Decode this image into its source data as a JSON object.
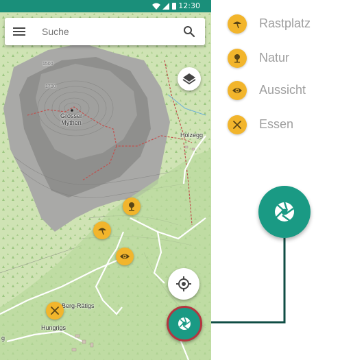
{
  "status_bar": {
    "time": "12:30"
  },
  "search": {
    "placeholder": "Suche"
  },
  "map_labels": {
    "peak": "Grosser\nMythen",
    "holzegg": "Holzegg",
    "berg_ratigs": "Berg-Rätigs",
    "hungrigs": "Hungrigs",
    "contour_a": "1500",
    "contour_b": "1700",
    "edge_g": "g"
  },
  "legend": [
    {
      "label": "Rastplatz",
      "icon": "picnic-umbrella-icon"
    },
    {
      "label": "Natur",
      "icon": "tree-icon"
    },
    {
      "label": "Aussicht",
      "icon": "eye-icon"
    },
    {
      "label": "Essen",
      "icon": "fork-knife-icon"
    }
  ],
  "colors": {
    "accent": "#1a9a84",
    "status_bar": "#1a8f7a",
    "poi": "#f2b52c",
    "camera_ring": "#b4353f",
    "connector": "#0f4d44",
    "legend_text": "#9e9e9e"
  },
  "icons": {
    "menu": "menu-icon",
    "search": "search-icon",
    "layers": "layers-icon",
    "locate": "gps-locate-icon",
    "camera": "camera-shutter-icon"
  }
}
